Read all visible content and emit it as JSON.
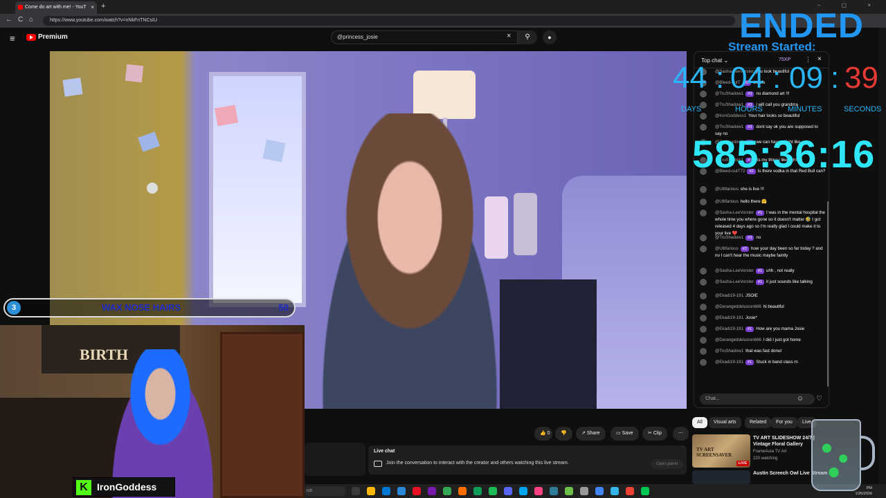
{
  "browser": {
    "tab_title": "Come do art with me! - YouT",
    "tab_close": "×",
    "new_tab": "+",
    "window_controls": "– ▢ ×",
    "url": "https://www.youtube.com/watch?v=nNkFnTNCsIU",
    "back": "←",
    "reload": "C",
    "home": "⌂"
  },
  "youtube": {
    "menu": "≡",
    "premium": "Premium",
    "search_value": "@princess_josie",
    "search_clear": "×",
    "search_icon": "⚲",
    "mic_icon": "●"
  },
  "goal_overlay": {
    "number": "3",
    "text": "WAX NOSE HAIRS",
    "value": "50"
  },
  "webcam": {
    "banner": "BIRTH",
    "streamer_name": "IronGoddess",
    "platform_mark": "K"
  },
  "video_actions": {
    "like_count": "0",
    "like_icon": "👍",
    "dislike_icon": "👎",
    "share": "Share",
    "save": "Save",
    "clip": "Clip",
    "more": "⋯"
  },
  "live_chat_box": {
    "title": "Live chat",
    "description": "Join the conversation to interact with the creator and others watching this live stream.",
    "open_panel": "Open panel"
  },
  "chat": {
    "header": "Top chat ⌄",
    "xp": "75XP",
    "more": "⋮",
    "close": "×",
    "input_placeholder": "Chat...",
    "emoji": "☺",
    "heart": "♡",
    "messages": [
      {
        "author": "@Sasha-LeeVorster",
        "badge": "",
        "text": "you look beautiful"
      },
      {
        "author": "@Bleed-outT",
        "badge": "#2",
        "text": "Woofs"
      },
      {
        "author": "@TruShadow1",
        "badge": "#3",
        "text": "no diamond art !!!"
      },
      {
        "author": "@TruShadow1",
        "badge": "#3",
        "text": "i will call you grandma"
      },
      {
        "author": "@IronGoddess1",
        "badge": "",
        "text": "Your hair looks so beautiful"
      },
      {
        "author": "@TruShadow1",
        "badge": "#3",
        "text": "dont say ok you are supposed to say no"
      },
      {
        "author": "@TruShadow1",
        "badge": "#3",
        "text": "we can have a fight like"
      },
      {
        "author": "@TruShadow1",
        "badge": "#3",
        "text": "its my thing i like fighting"
      },
      {
        "author": "@Bleed-outT72",
        "badge": "#2",
        "text": "Is there vodka in that Red Bull can?"
      },
      {
        "author": "@Ultifarious",
        "badge": "",
        "text": "she is live !!!"
      },
      {
        "author": "@Ultifarious",
        "badge": "",
        "text": "hello there 🤗"
      },
      {
        "author": "@Sasha-LeeVorster",
        "badge": "#1",
        "text": "I was in the mental hospital the whole time you where gone so it doesn't matter 🤣 I got released 4 days ago so I'm really glad I could make it to your live ❤️"
      },
      {
        "author": "@TruShadow1",
        "badge": "#3",
        "text": "no"
      },
      {
        "author": "@Ultifarious",
        "badge": "#2",
        "text": "how your day been so far today ? and no I can't hear the music maybe faintly"
      },
      {
        "author": "@Sasha-LeeVorster",
        "badge": "#1",
        "text": "uhh , not really"
      },
      {
        "author": "@Sasha-LeeVorster",
        "badge": "#1",
        "text": "it just sounds like talking"
      },
      {
        "author": "@Ekadi19-191",
        "badge": "",
        "text": "JSOIE"
      },
      {
        "author": "@Derangeddelusion666",
        "badge": "",
        "text": "hi beautiful"
      },
      {
        "author": "@Ekadi19-191",
        "badge": "",
        "text": "Josie*"
      },
      {
        "author": "@Ekadi19-191",
        "badge": "#1",
        "text": "How are you mama Josie"
      },
      {
        "author": "@Derangeddelusion666",
        "badge": "",
        "text": "I did I just got home"
      },
      {
        "author": "@TruShadow1",
        "badge": "",
        "text": "that was fast donut"
      },
      {
        "author": "@Ekadi19-191",
        "badge": "#1",
        "text": "Stuck in band class rn"
      }
    ]
  },
  "chips": [
    "All",
    "Visual arts",
    "Related",
    "For you",
    "Live"
  ],
  "recommendations": [
    {
      "title": "TV ART SLIDESHOW 24/7 | Vintage Floral Gallery",
      "thumb_text": "TV ART SCREENSAVER",
      "channel": "FrameAura TV Art",
      "views": "220 watching",
      "live_badge": "LIVE"
    },
    {
      "title": "Austin Screech Owl Live Stream",
      "thumb_text": "",
      "channel": "",
      "views": "",
      "live_badge": ""
    }
  ],
  "stream_overlay": {
    "status": "ENDED",
    "started_label": "Stream Started:",
    "days": "44",
    "hours": "04",
    "minutes": "09",
    "seconds": "39",
    "sep": ":",
    "days_label": "DAYS",
    "hours_label": "HOURS",
    "minutes_label": "MINUTES",
    "seconds_label": "SECONDS",
    "elapsed": "585:36:16"
  },
  "taskbar": {
    "search": "rch",
    "time": "PM",
    "date": "1/26/2026"
  },
  "colors": {
    "accent_blue": "#2196f3",
    "counter_cyan": "#2ee6f7",
    "seconds_red": "#e53935",
    "youtube_red": "#ff0000",
    "badge_purple": "#7b3fd1",
    "kick_green": "#53fc18"
  }
}
